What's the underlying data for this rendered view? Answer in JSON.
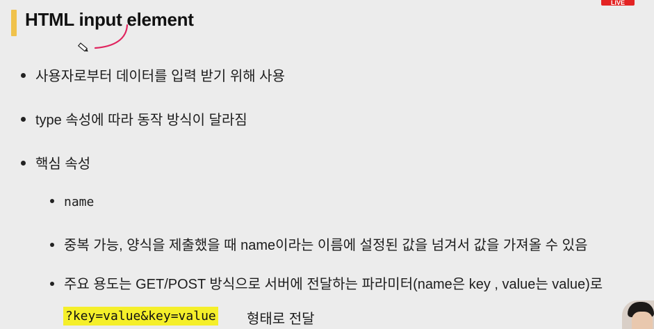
{
  "slide": {
    "title": "HTML input element",
    "live_badge": "LIVE",
    "bullets": [
      "사용자로부터 데이터를 입력 받기 위해 사용",
      "type 속성에 따라 동작 방식이 달라짐",
      "핵심 속성"
    ],
    "sub_bullets": [
      "name",
      "중복 가능, 양식을 제출했을 때 name이라는 이름에 설정된 값을 넘겨서 값을 가져올 수 있음",
      "주요 용도는 GET/POST 방식으로 서버에 전달하는 파라미터(name은 key , value는 value)로"
    ],
    "highlighted_code": "?key=value&key=value",
    "after_code_text": "형태로 전달"
  },
  "colors": {
    "background": "#ececec",
    "accent_bar": "#f0c24b",
    "highlight": "#f5ef2a",
    "live": "#e32323",
    "annotation_pen": "#e0245e"
  },
  "icons": [
    "pen-cursor-icon"
  ]
}
